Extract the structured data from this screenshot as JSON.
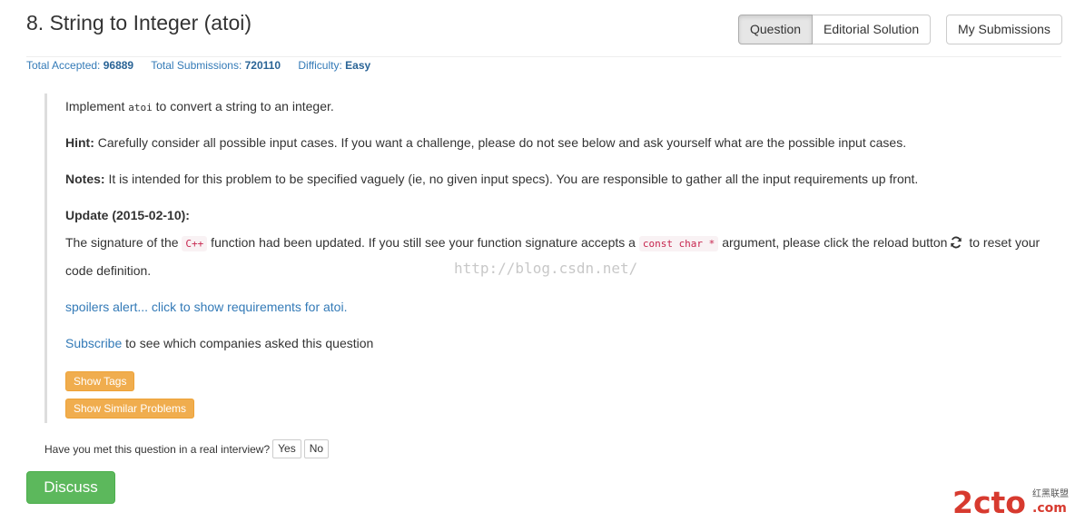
{
  "problem": {
    "title": "8. String to Integer (atoi)"
  },
  "actions": {
    "question": "Question",
    "editorial": "Editorial Solution",
    "submissions": "My Submissions"
  },
  "stats": {
    "accepted_label": "Total Accepted:",
    "accepted_value": "96889",
    "submissions_label": "Total Submissions:",
    "submissions_value": "720110",
    "difficulty_label": "Difficulty:",
    "difficulty_value": "Easy"
  },
  "description": {
    "line1_pre": "Implement ",
    "line1_code": "atoi",
    "line1_post": " to convert a string to an integer.",
    "hint_label": "Hint:",
    "hint_text": " Carefully consider all possible input cases. If you want a challenge, please do not see below and ask yourself what are the possible input cases.",
    "notes_label": "Notes:",
    "notes_text": " It is intended for this problem to be specified vaguely (ie, no given input specs). You are responsible to gather all the input requirements up front.",
    "update_heading": "Update (2015-02-10):",
    "sig_pre": "The signature of the ",
    "sig_code1": "C++",
    "sig_mid": " function had been updated. If you still see your function signature accepts a ",
    "sig_code2": "const char *",
    "sig_post": " argument, please click the reload button",
    "sig_end": " to reset your",
    "sig_line2": "code definition.",
    "spoilers": "spoilers alert... click to show requirements for atoi.",
    "subscribe_link": "Subscribe",
    "subscribe_text": " to see which companies asked this question",
    "show_tags": "Show Tags",
    "show_similar": "Show Similar Problems"
  },
  "interview": {
    "question": "Have you met this question in a real interview?",
    "yes": "Yes",
    "no": "No"
  },
  "discuss": "Discuss",
  "watermark": "http://blog.csdn.net/",
  "logo": {
    "main": "2cto",
    "domain": ".com",
    "cn": "红黑联盟"
  },
  "colors": {
    "link": "#337ab7",
    "update": "#dd1111",
    "tag": "#f0ad4e",
    "discuss": "#5cb85c"
  }
}
